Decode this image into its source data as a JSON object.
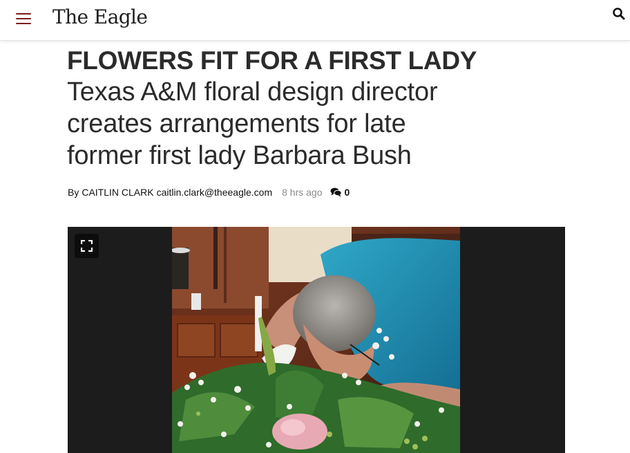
{
  "site": {
    "logo": "The Eagle"
  },
  "header": {
    "menu_icon": "hamburger-menu-icon",
    "search_icon": "search-icon"
  },
  "article": {
    "kicker": "FLOWERS FIT FOR A FIRST LADY",
    "title_lines": [
      "Texas A&M floral design director",
      "creates arrangements for late",
      "former first lady Barbara Bush"
    ],
    "byline": {
      "prefix": "By",
      "author": "CAITLIN CLARK",
      "email": "caitlin.clark@theeagle.com",
      "time": "8 hrs ago",
      "comment_count": "0"
    }
  },
  "media": {
    "expand_icon": "fullscreen-expand-icon"
  },
  "colors": {
    "menu": "#7a1c1c",
    "text": "#2b2b2b",
    "time": "#8a8a8a",
    "media_bg": "#1c1c1c"
  }
}
